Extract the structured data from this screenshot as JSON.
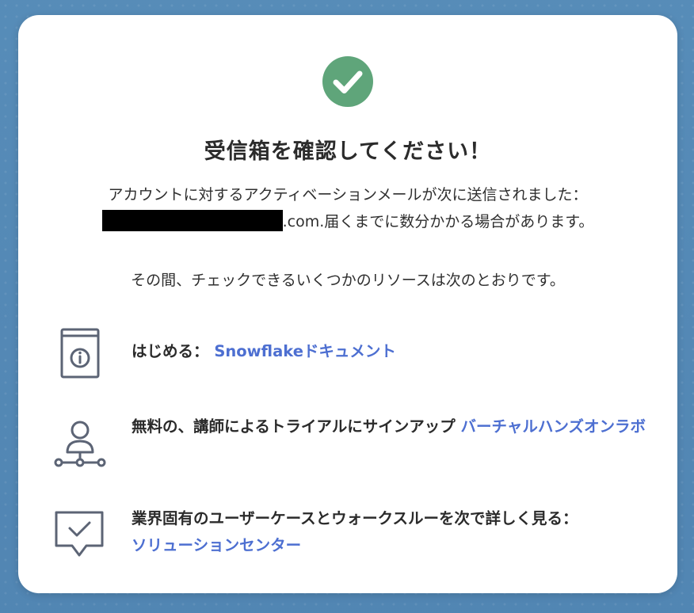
{
  "title": "受信箱を確認してください！",
  "message_line1": "アカウントに対するアクティベーションメールが次に送信されました：",
  "email_suffix": ".com",
  "message_line2_rest": ".届くまでに数分かかる場合があります。",
  "resources_intro": "その間、チェックできるいくつかのリソースは次のとおりです。",
  "items": [
    {
      "icon": "info-book-icon",
      "text": "はじめる：",
      "link": "Snowflakeドキュメント"
    },
    {
      "icon": "instructor-network-icon",
      "text": "無料の、講師によるトライアルにサインアップ",
      "link": "バーチャルハンズオンラボ"
    },
    {
      "icon": "chat-check-icon",
      "text": "業界固有のユーザーケースとウォークスルーを次で詳しく見る：",
      "link": "ソリューションセンター"
    }
  ],
  "colors": {
    "accent": "#4d6fd1",
    "success": "#5fa57a",
    "icon": "#5c6475"
  }
}
